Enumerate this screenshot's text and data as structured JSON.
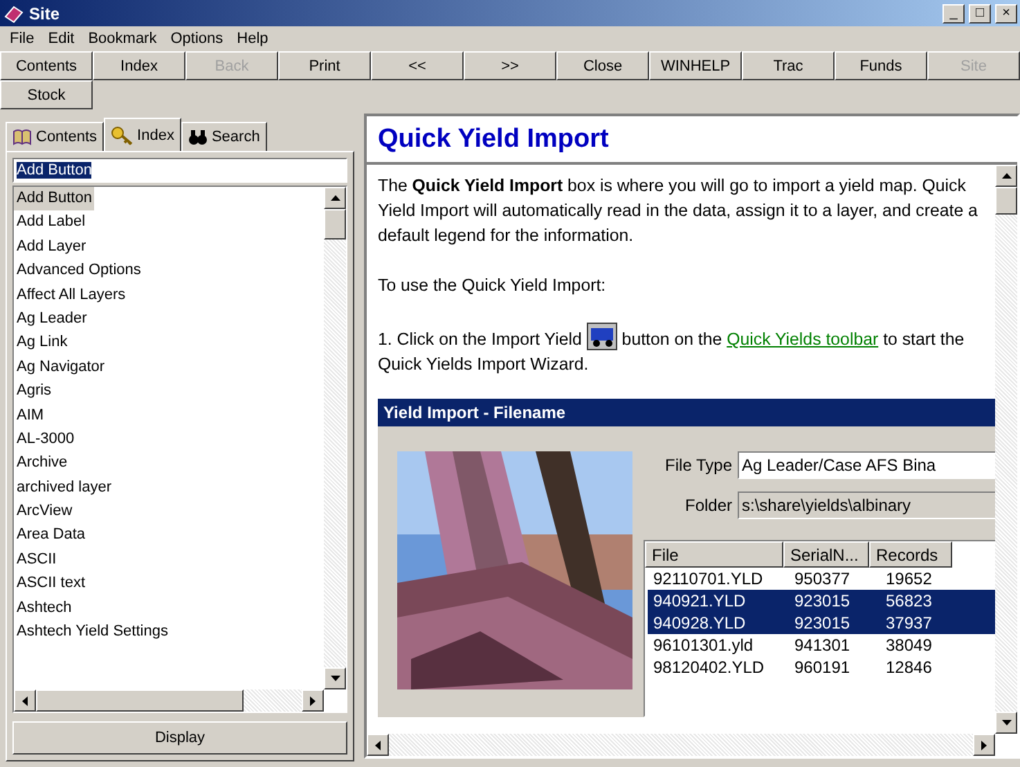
{
  "window": {
    "title": "Site",
    "controls": [
      "_",
      "□",
      "×"
    ]
  },
  "menu": [
    "File",
    "Edit",
    "Bookmark",
    "Options",
    "Help"
  ],
  "toolbar": [
    [
      {
        "label": "Contents",
        "disabled": false
      },
      {
        "label": "Index",
        "disabled": false
      },
      {
        "label": "Back",
        "disabled": true
      },
      {
        "label": "Print",
        "disabled": false
      },
      {
        "label": "<<",
        "disabled": false
      },
      {
        "label": ">>",
        "disabled": false
      },
      {
        "label": "Close",
        "disabled": false
      },
      {
        "label": "WINHELP",
        "disabled": false
      },
      {
        "label": "Trac",
        "disabled": false
      },
      {
        "label": "Funds",
        "disabled": false
      },
      {
        "label": "Site",
        "disabled": true
      }
    ],
    [
      {
        "label": "Stock",
        "disabled": false
      }
    ]
  ],
  "tabs": [
    {
      "label": "Contents",
      "kind": "book",
      "selected": false
    },
    {
      "label": "Index",
      "kind": "key",
      "selected": true
    },
    {
      "label": "Search",
      "kind": "binoculars",
      "selected": false
    }
  ],
  "index_field": {
    "value": "Add Button"
  },
  "index_list": [
    {
      "label": "Add Button",
      "selected": true
    },
    {
      "label": "Add Label",
      "selected": false
    },
    {
      "label": "Add Layer",
      "selected": false
    },
    {
      "label": "Advanced Options",
      "selected": false
    },
    {
      "label": "Affect All Layers",
      "selected": false
    },
    {
      "label": "Ag Leader",
      "selected": false
    },
    {
      "label": "Ag Link",
      "selected": false
    },
    {
      "label": "Ag Navigator",
      "selected": false
    },
    {
      "label": "Agris",
      "selected": false
    },
    {
      "label": "AIM",
      "selected": false
    },
    {
      "label": "AL-3000",
      "selected": false
    },
    {
      "label": "Archive",
      "selected": false
    },
    {
      "label": "archived layer",
      "selected": false
    },
    {
      "label": "ArcView",
      "selected": false
    },
    {
      "label": "Area Data",
      "selected": false
    },
    {
      "label": "ASCII",
      "selected": false
    },
    {
      "label": "ASCII text",
      "selected": false
    },
    {
      "label": "Ashtech",
      "selected": false
    },
    {
      "label": "Ashtech Yield Settings",
      "selected": false
    }
  ],
  "display_button": "Display",
  "topic": {
    "title": "Quick Yield Import",
    "paragraph_1": "The **Quick Yield Import** box is where you will go to import a yield map.  Quick Yield Import will automatically read in the data, assign it to a layer, and create a default legend for the information.",
    "paragraph_2": "To use the Quick Yield Import:",
    "step_1": {
      "before": "1.  Click on the Import Yield",
      "after": "button on the",
      "link": "Quick Yields toolbar",
      "end": "to start the Quick Yields Import Wizard."
    },
    "dialog": {
      "title": "Yield Import - Filename",
      "file_type_label": "File Type",
      "file_type": "Ag Leader/Case AFS Bina",
      "folder_label": "Folder",
      "folder": "s:\\share\\yields\\albinary",
      "columns": [
        "File",
        "SerialN...",
        "Records"
      ],
      "rows": [
        {
          "cells": [
            "92110701.YLD",
            "950377",
            "19652"
          ],
          "selected": false
        },
        {
          "cells": [
            "940921.YLD",
            "923015",
            "56823"
          ],
          "selected": true
        },
        {
          "cells": [
            "940928.YLD",
            "923015",
            "37937"
          ],
          "selected": true
        },
        {
          "cells": [
            "96101301.yld",
            "941301",
            "38049"
          ],
          "selected": false
        },
        {
          "cells": [
            "98120402.YLD",
            "960191",
            "12846"
          ],
          "selected": false
        }
      ]
    }
  }
}
